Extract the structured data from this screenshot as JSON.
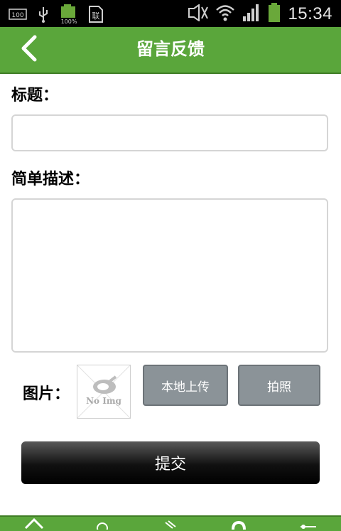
{
  "status_bar": {
    "time": "15:34",
    "battery_percent_label": "100%",
    "storage_label": "100",
    "icons": [
      "storage-icon",
      "usb-icon",
      "battery-charging-icon",
      "sim-icon",
      "mute-icon",
      "wifi-icon",
      "signal-icon",
      "battery-icon"
    ]
  },
  "header": {
    "title": "留言反馈",
    "back_icon": "chevron-left-icon",
    "background": "#5aa63b"
  },
  "form": {
    "title_label": "标题：",
    "title_value": "",
    "description_label": "简单描述：",
    "description_value": "",
    "image_label": "图片：",
    "no_image_text": "No Img",
    "upload_local_label": "本地上传",
    "take_photo_label": "拍照",
    "submit_label": "提交"
  },
  "tab_bar": {
    "icons": [
      "home-icon",
      "compass-icon",
      "clip-icon",
      "refresh-icon",
      "key-icon"
    ]
  }
}
